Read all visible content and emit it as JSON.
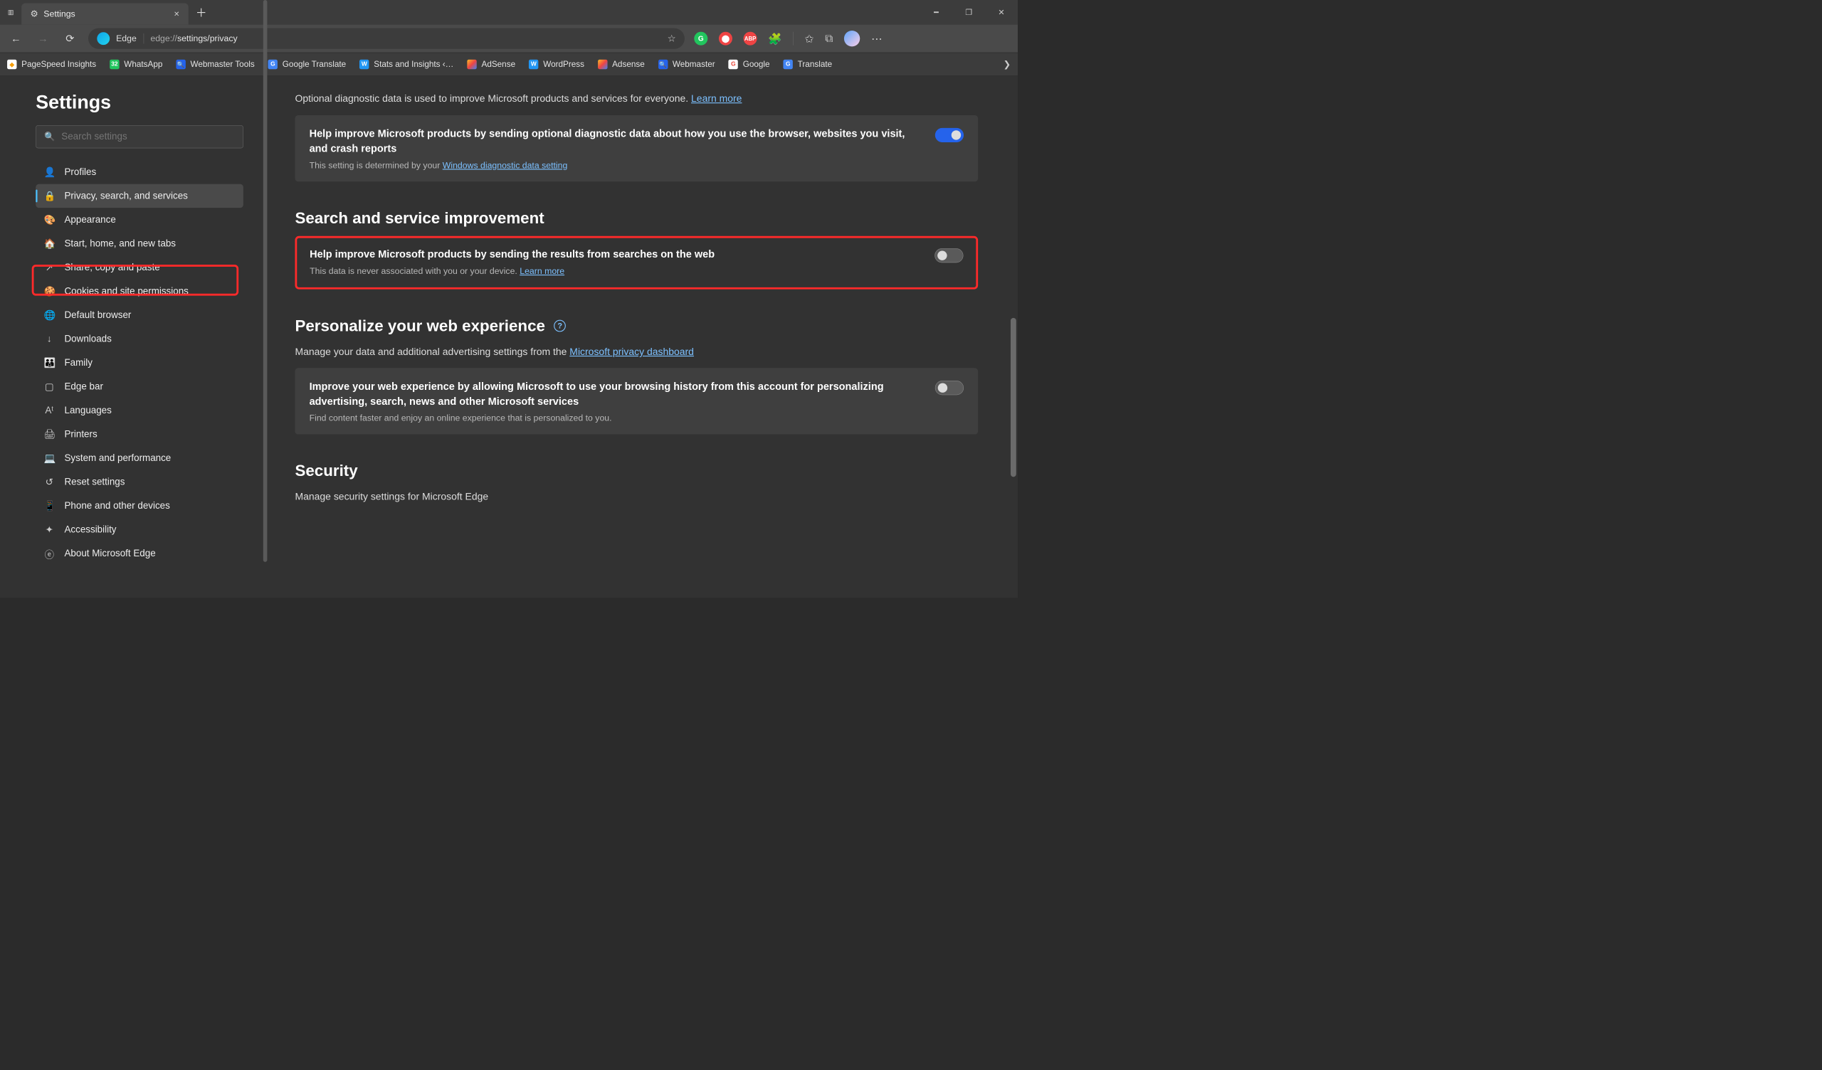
{
  "tab": {
    "title": "Settings"
  },
  "address": {
    "brand": "Edge",
    "url_prefix": "edge://",
    "url_mid": "settings/privacy"
  },
  "bookmarks": [
    {
      "label": "PageSpeed Insights",
      "bg": "#fff",
      "fg": "#f59e0b",
      "glyph": "◆"
    },
    {
      "label": "WhatsApp",
      "bg": "#22c55e",
      "fg": "#fff",
      "glyph": "32"
    },
    {
      "label": "Webmaster Tools",
      "bg": "#2563eb",
      "fg": "#fff",
      "glyph": "🔍"
    },
    {
      "label": "Google Translate",
      "bg": "#4285f4",
      "fg": "#fff",
      "glyph": "G"
    },
    {
      "label": "Stats and Insights ‹…",
      "bg": "#2196f3",
      "fg": "#fff",
      "glyph": "W"
    },
    {
      "label": "AdSense",
      "bg": "",
      "fg": "",
      "glyph": ""
    },
    {
      "label": "WordPress",
      "bg": "#2196f3",
      "fg": "#fff",
      "glyph": "W"
    },
    {
      "label": "Adsense",
      "bg": "",
      "fg": "",
      "glyph": ""
    },
    {
      "label": "Webmaster",
      "bg": "#2563eb",
      "fg": "#fff",
      "glyph": "🔍"
    },
    {
      "label": "Google",
      "bg": "#fff",
      "fg": "#ea4335",
      "glyph": "G"
    },
    {
      "label": "Translate",
      "bg": "#4285f4",
      "fg": "#fff",
      "glyph": "G"
    }
  ],
  "sidebar": {
    "title": "Settings",
    "search_placeholder": "Search settings",
    "items": [
      {
        "icon": "👤",
        "label": "Profiles"
      },
      {
        "icon": "🔒",
        "label": "Privacy, search, and services"
      },
      {
        "icon": "🎨",
        "label": "Appearance"
      },
      {
        "icon": "🏠",
        "label": "Start, home, and new tabs"
      },
      {
        "icon": "↗",
        "label": "Share, copy and paste"
      },
      {
        "icon": "🍪",
        "label": "Cookies and site permissions"
      },
      {
        "icon": "🌐",
        "label": "Default browser"
      },
      {
        "icon": "↓",
        "label": "Downloads"
      },
      {
        "icon": "👪",
        "label": "Family"
      },
      {
        "icon": "▢",
        "label": "Edge bar"
      },
      {
        "icon": "Aᵗ",
        "label": "Languages"
      },
      {
        "icon": "🖨",
        "label": "Printers"
      },
      {
        "icon": "💻",
        "label": "System and performance"
      },
      {
        "icon": "↺",
        "label": "Reset settings"
      },
      {
        "icon": "📱",
        "label": "Phone and other devices"
      },
      {
        "icon": "✦",
        "label": "Accessibility"
      },
      {
        "icon": "ⓔ",
        "label": "About Microsoft Edge"
      }
    ]
  },
  "main": {
    "diag_intro": "Optional diagnostic data is used to improve Microsoft products and services for everyone. ",
    "diag_learn": "Learn more",
    "diag_card_title": "Help improve Microsoft products by sending optional diagnostic data about how you use the browser, websites you visit, and crash reports",
    "diag_card_sub_pre": "This setting is determined by your ",
    "diag_card_sub_link": "Windows diagnostic data setting",
    "heading_search": "Search and service improvement",
    "search_card_title": "Help improve Microsoft products by sending the results from searches on the web",
    "search_card_sub_pre": "This data is never associated with you or your device. ",
    "search_card_sub_link": "Learn more",
    "heading_pers": "Personalize your web experience",
    "pers_intro_pre": "Manage your data and additional advertising settings from the ",
    "pers_intro_link": "Microsoft privacy dashboard",
    "pers_card_title": "Improve your web experience by allowing Microsoft to use your browsing history from this account for personalizing advertising, search, news and other Microsoft services",
    "pers_card_sub": "Find content faster and enjoy an online experience that is personalized to you.",
    "heading_sec": "Security",
    "sec_intro": "Manage security settings for Microsoft Edge"
  }
}
